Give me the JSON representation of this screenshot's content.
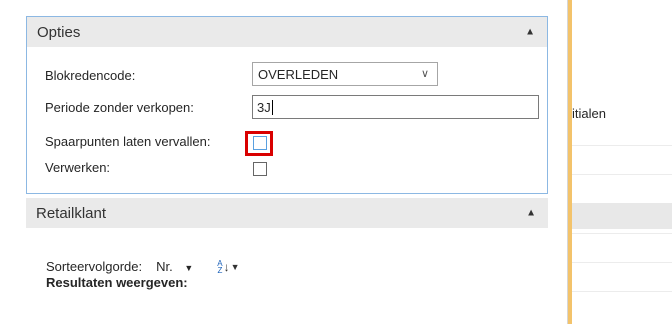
{
  "options_tab": {
    "title": "Opties",
    "fields": {
      "block_code_label": "Blokredencode:",
      "block_code_value": "OVERLEDEN",
      "period_label": "Periode zonder verkopen:",
      "period_value": "3J",
      "expire_points_label": "Spaarpunten laten vervallen:",
      "expire_points_checked": false,
      "process_label": "Verwerken:",
      "process_checked": false
    }
  },
  "retail_tab": {
    "title": "Retailklant",
    "sort_label": "Sorteervolgorde:",
    "sort_field": "Nr.",
    "results_label": "Resultaten weergeven:"
  },
  "background_page": {
    "column_header_fragment": "itialen"
  },
  "colors": {
    "accent_border": "#8cb8e3",
    "highlight": "#d90000",
    "page_edge": "#f3c36b"
  }
}
